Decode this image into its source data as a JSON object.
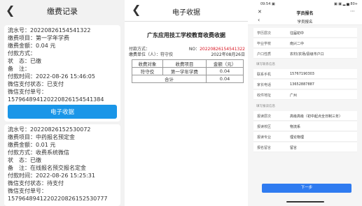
{
  "panel1": {
    "back_icon": "chevron-left-icon",
    "title": "缴费记录",
    "record1": {
      "serial": "流水号：20220826154541322",
      "item": "缴费项目：第一学年学费",
      "amount": "缴费金额：0.04 元",
      "pay_method": "付款方式：",
      "status": "状　态：已缴",
      "remark": "备　注：",
      "pay_time": "付款时间：2022-08-26 15:46:05",
      "wx_status": "微信支付状态：已支付",
      "wx_order_label": "微信支付单号：",
      "wx_order": "157964894120220826154541384",
      "button": "电子收据"
    },
    "record2": {
      "serial": "流水号：20220826152530072",
      "item": "缴费项目：中药报名预定金",
      "amount": "缴费金额：0.01 元",
      "pay_method": "付款方式：收费系统微信",
      "status": "状　态：已缴",
      "remark": "备　注：在线报名预交报名定金",
      "pay_time": "付款时间：2022-08-26 15:25:31",
      "wx_status": "微信支付状态：待支付",
      "wx_order_label": "微信支付单号：",
      "wx_order": "1579648941220220826152530777"
    }
  },
  "panel2": {
    "back_icon": "chevron-left-icon",
    "title": "电子收据",
    "org": "广东应用技工学校教育收费收据",
    "pay_method": "付款方式：",
    "no_label": "NO：",
    "no_value": "20220826154541322",
    "payer": "缴费单位（人）：符守佼",
    "date": "2022年08月26日",
    "table": {
      "headers": [
        "收费对象",
        "收费项目",
        "金额（元）"
      ],
      "row": [
        "符守佼",
        "第一学年学费",
        "0.04"
      ],
      "total_label": "合计",
      "total_value": "0.04"
    }
  },
  "panel3": {
    "status_left": "09:54 ▣",
    "status_right": "▣ ▣ ▂ ▅ 80+",
    "close_icon": "close-icon",
    "window_title": "学员报名",
    "more_icon": "more-icon",
    "back_icon": "chevron-left-icon",
    "page_title": "学员报名",
    "fields_a": [
      {
        "label": "学历层次",
        "value": "往届初中"
      },
      {
        "label": "毕业学校",
        "value": "南兴二中"
      },
      {
        "label": "户口性质",
        "value": "农村(农场/县级市户口"
      }
    ],
    "section_contact": "填写联系信息",
    "fields_b": [
      {
        "label": "联系手机",
        "value": "15767190303"
      },
      {
        "label": "家长电话",
        "value": "13652887887"
      },
      {
        "label": "收件地址",
        "value": "广州"
      }
    ],
    "section_major": "填写报读信息",
    "fields_c": [
      {
        "label": "报读层次",
        "value": "高级高级（初中起点全日制三年）"
      },
      {
        "label": "报读校区",
        "value": "物流系"
      },
      {
        "label": "报读专业",
        "value": "理论物理"
      },
      {
        "label": "报名留言",
        "value": "留言"
      }
    ],
    "next_button": "下一步"
  }
}
